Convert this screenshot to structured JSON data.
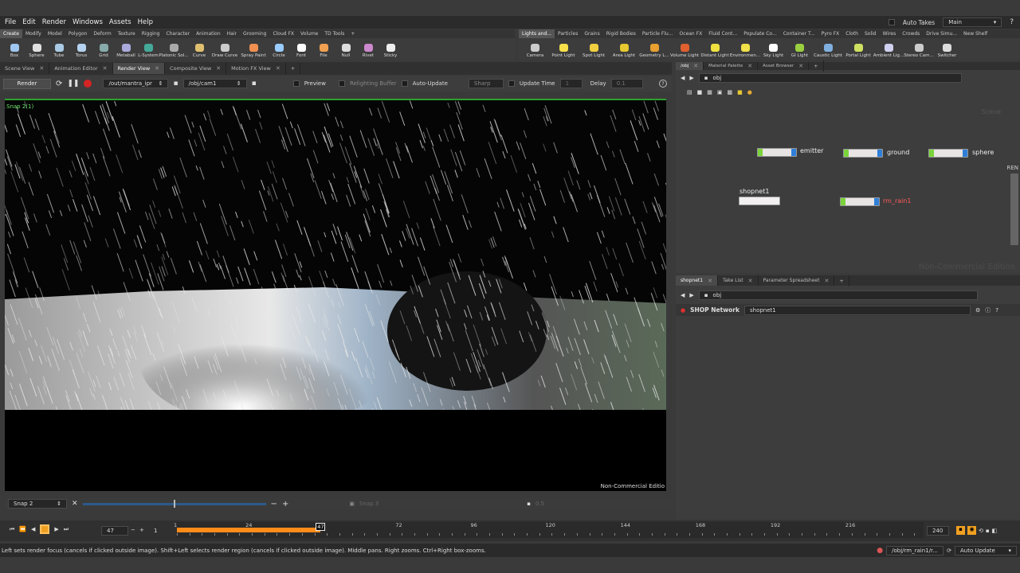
{
  "menubar": {
    "items": [
      "File",
      "Edit",
      "Render",
      "Windows",
      "Assets",
      "Help"
    ],
    "auto_takes": "Auto Takes",
    "desktop": "Main"
  },
  "shelf_tabs_left": [
    "Create",
    "Modify",
    "Model",
    "Polygon",
    "Deform",
    "Texture",
    "Rigging",
    "Character",
    "Animation",
    "Hair",
    "Grooming",
    "Cloud FX",
    "Volume",
    "TD Tools"
  ],
  "shelf_tabs_right": [
    "Lights and...",
    "Particles",
    "Grains",
    "Rigid Bodies",
    "Particle Flu...",
    "Ocean FX",
    "Fluid Cont...",
    "Populate Co...",
    "Container T...",
    "Pyro FX",
    "Cloth",
    "Solid",
    "Wires",
    "Crowds",
    "Drive Simu...",
    "New Shelf"
  ],
  "tools_left": [
    "Box",
    "Sphere",
    "Tube",
    "Torus",
    "Grid",
    "Metaball",
    "L-System",
    "Platonic Sol...",
    "Curve",
    "Draw Curve",
    "Spray Paint",
    "Circle",
    "Font",
    "File",
    "Null",
    "Rivet",
    "Sticky"
  ],
  "tools_right": [
    "Camera",
    "Point Light",
    "Spot Light",
    "Area Light",
    "Geometry L...",
    "Volume Light",
    "Distant Light",
    "Environmen...",
    "Sky Light",
    "GI Light",
    "Caustic Light",
    "Portal Light",
    "Ambient Lig...",
    "Stereo Cam...",
    "Switcher"
  ],
  "pane_tabs": [
    "Scene View",
    "Animation Editor",
    "Render View",
    "Composite View",
    "Motion FX View"
  ],
  "render_toolbar": {
    "render_label": "Render",
    "output_path": "/out/mantra_ipr",
    "camera_path": "/obj/cam1",
    "preview": "Preview",
    "relighting": "Relighting Buffer",
    "auto_update": "Auto-Update",
    "sharp": "Sharp",
    "update_time": "Update Time",
    "delay": "Delay",
    "delay_value": "0.1"
  },
  "viewport": {
    "snap_label": "Snap 2(1)",
    "watermark": "Non-Commercial Editio"
  },
  "snapbar": {
    "snap_select": "Snap 2",
    "snap_right": "Snap 3",
    "value": "0.5"
  },
  "network_tabs": [
    "/obj",
    "Material Palette",
    "Asset Browser"
  ],
  "network": {
    "path": "obj",
    "scene_label": "Scene",
    "watermark": "Non-Commercial Edition",
    "edge_label": "REN",
    "nodes": {
      "emitter": "emitter",
      "ground": "ground",
      "sphere": "sphere",
      "shopnet": "shopnet1",
      "rain": "rm_rain1"
    }
  },
  "param_tabs": [
    "shopnet1",
    "Take List",
    "Parameter Spreadsheet"
  ],
  "params": {
    "path": "obj",
    "type_label": "SHOP Network",
    "node_name": "shopnet1"
  },
  "timeline": {
    "current_frame": "47",
    "start_frame": "1",
    "end_frame": "240",
    "ticks": [
      "1",
      "24",
      "47",
      "72",
      "96",
      "120",
      "144",
      "168",
      "192",
      "216"
    ],
    "playhead_frame": 47,
    "range_start": 1,
    "range_end": 240
  },
  "status": {
    "message": "Left sets render focus (cancels if clicked outside image). Shift+Left selects render region (cancels if clicked outside image). Middle pans. Right zooms. Ctrl+Right box-zooms.",
    "node_path": "/obj/rm_rain1/r...",
    "auto_update": "Auto Update"
  },
  "colors": {
    "accent_green": "#2ea12e",
    "timeline_orange": "#ff8c1a",
    "node_green": "#7ad33a",
    "node_blue": "#2f7fd8",
    "rain_node_text": "#ff5a5a"
  }
}
